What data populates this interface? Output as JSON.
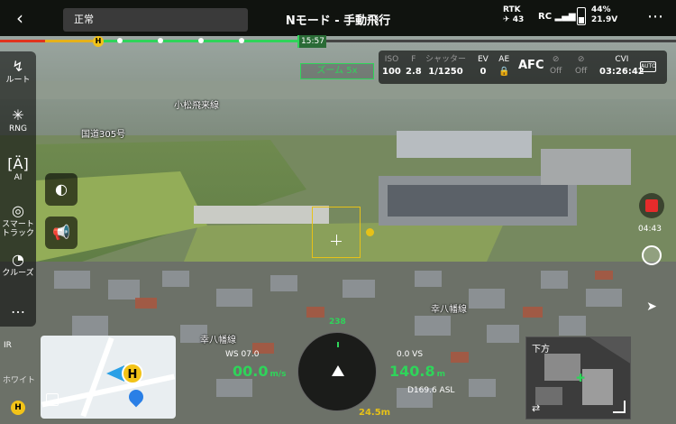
{
  "top_bar": {
    "status": "正常",
    "mode_title": "Nモード - 手動飛行",
    "rtk_label": "RTK",
    "rtk_count": "43",
    "rc_label": "RC",
    "battery_percent": "44%",
    "battery_voltage": "21.9V"
  },
  "progress": {
    "home_marker": "H",
    "time_label": "15:57"
  },
  "left_panel": {
    "items": [
      {
        "label": "ルート",
        "icon": "route-icon"
      },
      {
        "label": "RNG",
        "icon": "rng-icon"
      },
      {
        "label": "AI",
        "icon": "ai-icon"
      },
      {
        "label": "スマートトラック",
        "icon": "smart-track-icon"
      },
      {
        "label": "クルーズ",
        "icon": "cruise-icon"
      },
      {
        "label": "…",
        "icon": "more-icon"
      }
    ]
  },
  "camera_settings": {
    "zoom_tag": "ズーム 5x",
    "iso_label": "ISO",
    "iso_value": "100",
    "f_label": "F",
    "f_value": "2.8",
    "shutter_label": "シャッター",
    "shutter_value": "1/1250",
    "ev_label": "EV",
    "ev_value": "0",
    "ae_label": "AE",
    "af_value": "AFC",
    "off1": "Off",
    "off2": "Off",
    "storage_label": "CVI",
    "record_time": "03:26:42",
    "auto_badge": "AUTO"
  },
  "map_labels": {
    "station": "小松飛来線",
    "route305": "国道305号",
    "line_a": "幸八幡線",
    "line_b": "幸八幡線"
  },
  "right_rail": {
    "rec_time": "04:43"
  },
  "minimap": {
    "home_marker": "H",
    "ir_label": "IR",
    "white_label": "ホワイト",
    "corner_h": "H"
  },
  "telemetry": {
    "heading": "238",
    "wind_speed": "WS 07.0",
    "h_speed": "00.0",
    "h_speed_unit": "m/s",
    "vs_label": "0.0 VS",
    "altitude": "140.8",
    "alt_unit": "m",
    "asl": "D169.6 ASL",
    "distance": "24.5m"
  },
  "pip": {
    "label": "下方"
  },
  "colors": {
    "accent_green": "#2fd45a",
    "home_yellow": "#f2c318",
    "rec_red": "#e52b2b"
  }
}
